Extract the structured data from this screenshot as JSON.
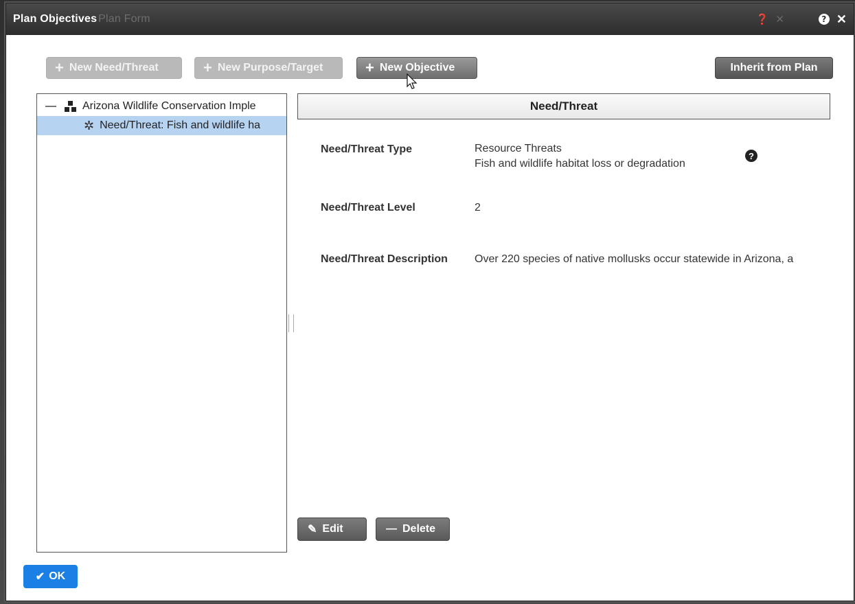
{
  "dialog": {
    "title": "Plan Objectives",
    "title_ghost": "Plan Form"
  },
  "toolbar": {
    "new_need_threat": "New Need/Threat",
    "new_purpose_target": "New Purpose/Target",
    "new_objective": "New Objective",
    "inherit_from_plan": "Inherit from Plan"
  },
  "tree": {
    "root_label": "Arizona Wildlife Conservation Imple",
    "child_label": "Need/Threat: Fish and wildlife ha"
  },
  "detail": {
    "header": "Need/Threat",
    "fields": [
      {
        "label": "Need/Threat Type",
        "lines": [
          "Resource Threats",
          "Fish and wildlife habitat loss or degradation"
        ]
      },
      {
        "label": "Need/Threat Level",
        "lines": [
          "2"
        ]
      },
      {
        "label": "Need/Threat Description",
        "lines": [
          "Over 220 species of native mollusks occur statewide in Arizona, a"
        ]
      }
    ],
    "edit_label": "Edit",
    "delete_label": "Delete"
  },
  "footer": {
    "ok_label": "OK"
  },
  "icons": {
    "help": "?",
    "close": "✕"
  },
  "colors": {
    "titlebar": "#2c2c2c",
    "selected_row": "#b7d3f2",
    "ok_button": "#1a80e6",
    "disabled_button": "#b9b9b9"
  }
}
